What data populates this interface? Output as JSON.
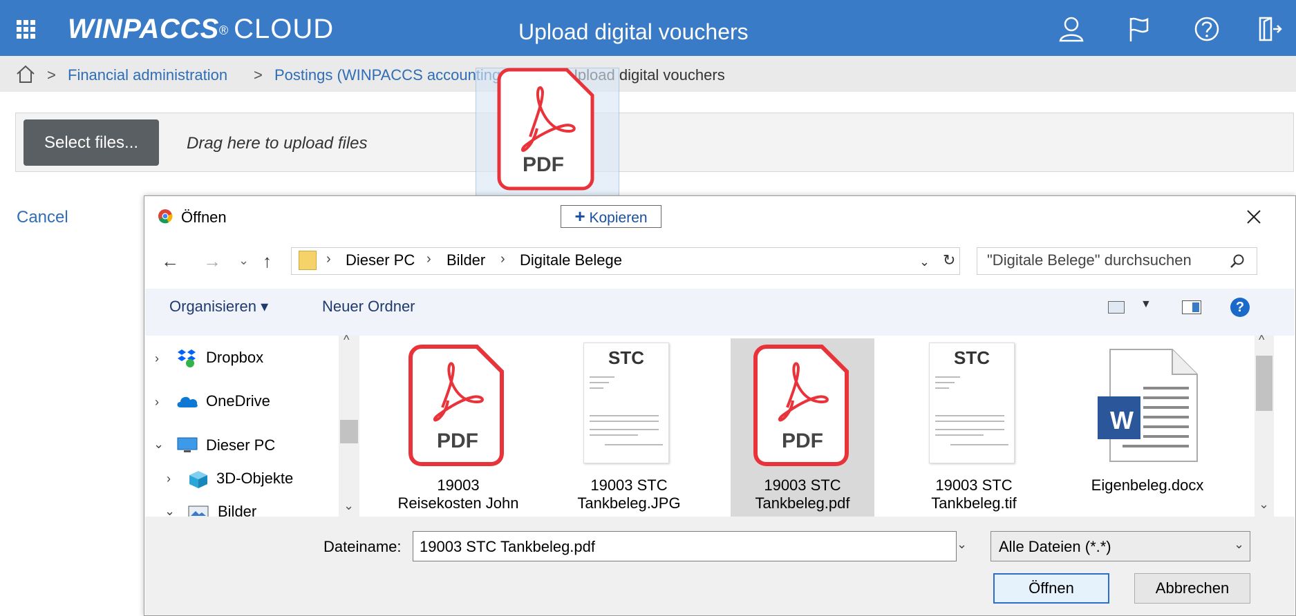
{
  "header": {
    "brand_bold": "WINPACCS",
    "brand_reg": "®",
    "brand_light": "CLOUD",
    "title": "Upload digital vouchers"
  },
  "breadcrumb": {
    "items": [
      "Financial administration",
      "Postings (WINPACCS accounting 4)",
      "Upload digital vouchers"
    ],
    "separator": ">"
  },
  "upload": {
    "select_label": "Select files...",
    "drag_hint": "Drag here to upload files",
    "cancel_label": "Cancel",
    "drag_ghost_label": "PDF"
  },
  "dialog": {
    "title": "Öffnen",
    "copy_plus": "+",
    "copy_label": "Kopieren",
    "path": [
      "Dieser PC",
      "Bilder",
      "Digitale Belege"
    ],
    "path_separator": "›",
    "search_placeholder": "\"Digitale Belege\" durchsuchen",
    "toolbar": {
      "organize": "Organisieren ▾",
      "new_folder": "Neuer Ordner"
    },
    "nav_items": [
      {
        "label": "Dropbox",
        "chevron": "›",
        "icon": "dropbox-icon"
      },
      {
        "label": "OneDrive",
        "chevron": "›",
        "icon": "onedrive-icon"
      },
      {
        "label": "Dieser PC",
        "chevron": "⌄",
        "icon": "computer-icon"
      },
      {
        "label": "3D-Objekte",
        "chevron": "›",
        "icon": "3d-objects-icon"
      },
      {
        "label": "Bilder",
        "chevron": "⌄",
        "icon": "pictures-icon"
      }
    ],
    "files": [
      {
        "line1": "19003",
        "line2": "Reisekosten John",
        "type": "pdf",
        "icon_text": "PDF"
      },
      {
        "line1": "19003 STC",
        "line2": "Tankbeleg.JPG",
        "type": "receipt",
        "icon_text": "STC"
      },
      {
        "line1": "19003 STC",
        "line2": "Tankbeleg.pdf",
        "type": "pdf",
        "icon_text": "PDF",
        "selected": true
      },
      {
        "line1": "19003 STC",
        "line2": "Tankbeleg.tif",
        "type": "receipt",
        "icon_text": "STC"
      },
      {
        "line1": "Eigenbeleg.docx",
        "line2": "",
        "type": "word",
        "icon_text": "W"
      }
    ],
    "filename_label": "Dateiname:",
    "filename_value": "19003 STC Tankbeleg.pdf",
    "filetype_value": "Alle Dateien (*.*)",
    "open_label": "Öffnen",
    "cancel_label": "Abbrechen"
  },
  "colors": {
    "header_bg": "#3a7bc8",
    "link": "#2f6db5",
    "pdf_red": "#e8333a",
    "selection": "#d9d9d9"
  }
}
